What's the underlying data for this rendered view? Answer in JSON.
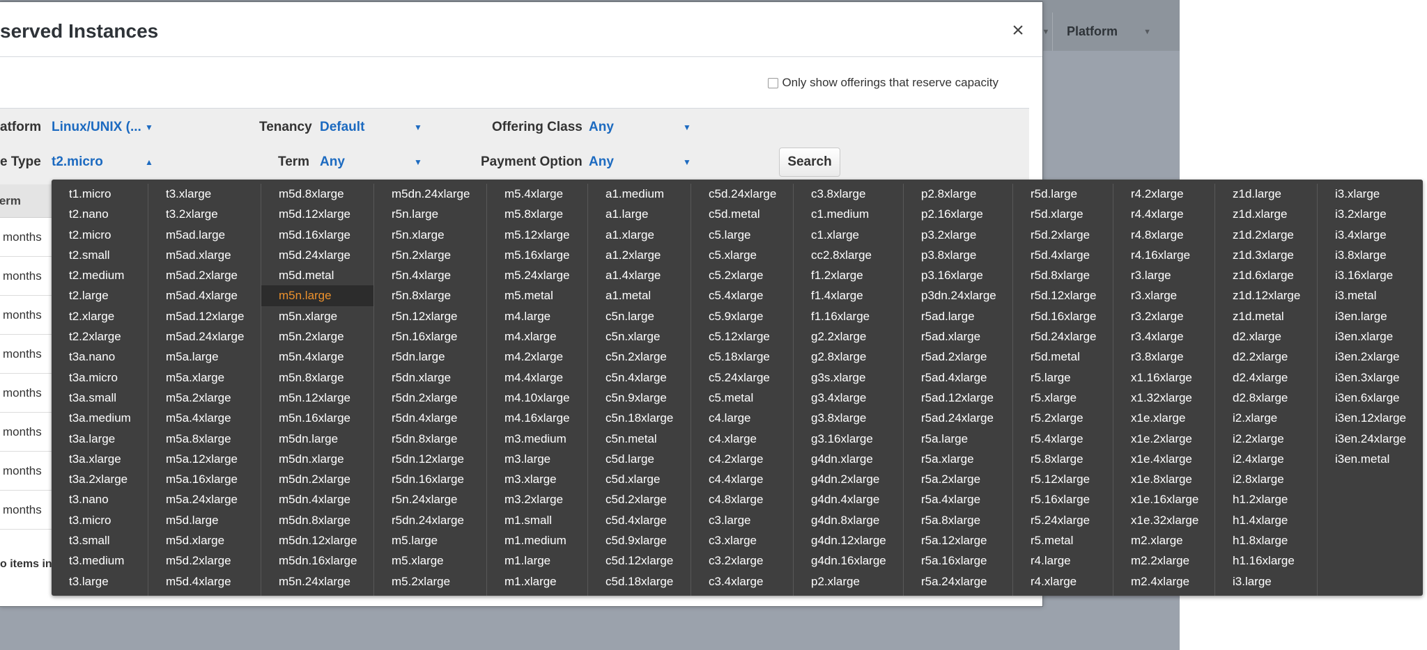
{
  "modal": {
    "title": "served Instances",
    "close_symbol": "×",
    "reserve_checkbox_label": "Only show offerings that reserve capacity"
  },
  "background_header": {
    "platform_col": "Platform"
  },
  "filters": {
    "platform_label": "atform",
    "platform_value": "Linux/UNIX (...",
    "tenancy_label": "Tenancy",
    "tenancy_value": "Default",
    "offering_class_label": "Offering Class",
    "offering_class_value": "Any",
    "instance_type_label": "e Type",
    "instance_type_value": "t2.micro",
    "term_label": "Term",
    "term_value": "Any",
    "payment_option_label": "Payment Option",
    "payment_option_value": "Any",
    "search_label": "Search"
  },
  "table": {
    "term_header": "erm",
    "rows": [
      "months",
      "months",
      "months",
      "months",
      "months",
      "months",
      "months",
      "months"
    ],
    "footer": "o items in y"
  },
  "dropdown": {
    "highlighted": "m5n.large",
    "columns": [
      [
        "t1.micro",
        "t2.nano",
        "t2.micro",
        "t2.small",
        "t2.medium",
        "t2.large",
        "t2.xlarge",
        "t2.2xlarge",
        "t3a.nano",
        "t3a.micro",
        "t3a.small",
        "t3a.medium",
        "t3a.large",
        "t3a.xlarge",
        "t3a.2xlarge",
        "t3.nano",
        "t3.micro",
        "t3.small",
        "t3.medium",
        "t3.large"
      ],
      [
        "t3.xlarge",
        "t3.2xlarge",
        "m5ad.large",
        "m5ad.xlarge",
        "m5ad.2xlarge",
        "m5ad.4xlarge",
        "m5ad.12xlarge",
        "m5ad.24xlarge",
        "m5a.large",
        "m5a.xlarge",
        "m5a.2xlarge",
        "m5a.4xlarge",
        "m5a.8xlarge",
        "m5a.12xlarge",
        "m5a.16xlarge",
        "m5a.24xlarge",
        "m5d.large",
        "m5d.xlarge",
        "m5d.2xlarge",
        "m5d.4xlarge"
      ],
      [
        "m5d.8xlarge",
        "m5d.12xlarge",
        "m5d.16xlarge",
        "m5d.24xlarge",
        "m5d.metal",
        "m5n.large",
        "m5n.xlarge",
        "m5n.2xlarge",
        "m5n.4xlarge",
        "m5n.8xlarge",
        "m5n.12xlarge",
        "m5n.16xlarge",
        "m5dn.large",
        "m5dn.xlarge",
        "m5dn.2xlarge",
        "m5dn.4xlarge",
        "m5dn.8xlarge",
        "m5dn.12xlarge",
        "m5dn.16xlarge",
        "m5n.24xlarge"
      ],
      [
        "m5dn.24xlarge",
        "r5n.large",
        "r5n.xlarge",
        "r5n.2xlarge",
        "r5n.4xlarge",
        "r5n.8xlarge",
        "r5n.12xlarge",
        "r5n.16xlarge",
        "r5dn.large",
        "r5dn.xlarge",
        "r5dn.2xlarge",
        "r5dn.4xlarge",
        "r5dn.8xlarge",
        "r5dn.12xlarge",
        "r5dn.16xlarge",
        "r5n.24xlarge",
        "r5dn.24xlarge",
        "m5.large",
        "m5.xlarge",
        "m5.2xlarge"
      ],
      [
        "m5.4xlarge",
        "m5.8xlarge",
        "m5.12xlarge",
        "m5.16xlarge",
        "m5.24xlarge",
        "m5.metal",
        "m4.large",
        "m4.xlarge",
        "m4.2xlarge",
        "m4.4xlarge",
        "m4.10xlarge",
        "m4.16xlarge",
        "m3.medium",
        "m3.large",
        "m3.xlarge",
        "m3.2xlarge",
        "m1.small",
        "m1.medium",
        "m1.large",
        "m1.xlarge"
      ],
      [
        "a1.medium",
        "a1.large",
        "a1.xlarge",
        "a1.2xlarge",
        "a1.4xlarge",
        "a1.metal",
        "c5n.large",
        "c5n.xlarge",
        "c5n.2xlarge",
        "c5n.4xlarge",
        "c5n.9xlarge",
        "c5n.18xlarge",
        "c5n.metal",
        "c5d.large",
        "c5d.xlarge",
        "c5d.2xlarge",
        "c5d.4xlarge",
        "c5d.9xlarge",
        "c5d.12xlarge",
        "c5d.18xlarge"
      ],
      [
        "c5d.24xlarge",
        "c5d.metal",
        "c5.large",
        "c5.xlarge",
        "c5.2xlarge",
        "c5.4xlarge",
        "c5.9xlarge",
        "c5.12xlarge",
        "c5.18xlarge",
        "c5.24xlarge",
        "c5.metal",
        "c4.large",
        "c4.xlarge",
        "c4.2xlarge",
        "c4.4xlarge",
        "c4.8xlarge",
        "c3.large",
        "c3.xlarge",
        "c3.2xlarge",
        "c3.4xlarge"
      ],
      [
        "c3.8xlarge",
        "c1.medium",
        "c1.xlarge",
        "cc2.8xlarge",
        "f1.2xlarge",
        "f1.4xlarge",
        "f1.16xlarge",
        "g2.2xlarge",
        "g2.8xlarge",
        "g3s.xlarge",
        "g3.4xlarge",
        "g3.8xlarge",
        "g3.16xlarge",
        "g4dn.xlarge",
        "g4dn.2xlarge",
        "g4dn.4xlarge",
        "g4dn.8xlarge",
        "g4dn.12xlarge",
        "g4dn.16xlarge",
        "p2.xlarge"
      ],
      [
        "p2.8xlarge",
        "p2.16xlarge",
        "p3.2xlarge",
        "p3.8xlarge",
        "p3.16xlarge",
        "p3dn.24xlarge",
        "r5ad.large",
        "r5ad.xlarge",
        "r5ad.2xlarge",
        "r5ad.4xlarge",
        "r5ad.12xlarge",
        "r5ad.24xlarge",
        "r5a.large",
        "r5a.xlarge",
        "r5a.2xlarge",
        "r5a.4xlarge",
        "r5a.8xlarge",
        "r5a.12xlarge",
        "r5a.16xlarge",
        "r5a.24xlarge"
      ],
      [
        "r5d.large",
        "r5d.xlarge",
        "r5d.2xlarge",
        "r5d.4xlarge",
        "r5d.8xlarge",
        "r5d.12xlarge",
        "r5d.16xlarge",
        "r5d.24xlarge",
        "r5d.metal",
        "r5.large",
        "r5.xlarge",
        "r5.2xlarge",
        "r5.4xlarge",
        "r5.8xlarge",
        "r5.12xlarge",
        "r5.16xlarge",
        "r5.24xlarge",
        "r5.metal",
        "r4.large",
        "r4.xlarge"
      ],
      [
        "r4.2xlarge",
        "r4.4xlarge",
        "r4.8xlarge",
        "r4.16xlarge",
        "r3.large",
        "r3.xlarge",
        "r3.2xlarge",
        "r3.4xlarge",
        "r3.8xlarge",
        "x1.16xlarge",
        "x1.32xlarge",
        "x1e.xlarge",
        "x1e.2xlarge",
        "x1e.4xlarge",
        "x1e.8xlarge",
        "x1e.16xlarge",
        "x1e.32xlarge",
        "m2.xlarge",
        "m2.2xlarge",
        "m2.4xlarge"
      ],
      [
        "z1d.large",
        "z1d.xlarge",
        "z1d.2xlarge",
        "z1d.3xlarge",
        "z1d.6xlarge",
        "z1d.12xlarge",
        "z1d.metal",
        "d2.xlarge",
        "d2.2xlarge",
        "d2.4xlarge",
        "d2.8xlarge",
        "i2.xlarge",
        "i2.2xlarge",
        "i2.4xlarge",
        "i2.8xlarge",
        "h1.2xlarge",
        "h1.4xlarge",
        "h1.8xlarge",
        "h1.16xlarge",
        "i3.large"
      ],
      [
        "i3.xlarge",
        "i3.2xlarge",
        "i3.4xlarge",
        "i3.8xlarge",
        "i3.16xlarge",
        "i3.metal",
        "i3en.large",
        "i3en.xlarge",
        "i3en.2xlarge",
        "i3en.3xlarge",
        "i3en.6xlarge",
        "i3en.12xlarge",
        "i3en.24xlarge",
        "i3en.metal"
      ]
    ]
  }
}
